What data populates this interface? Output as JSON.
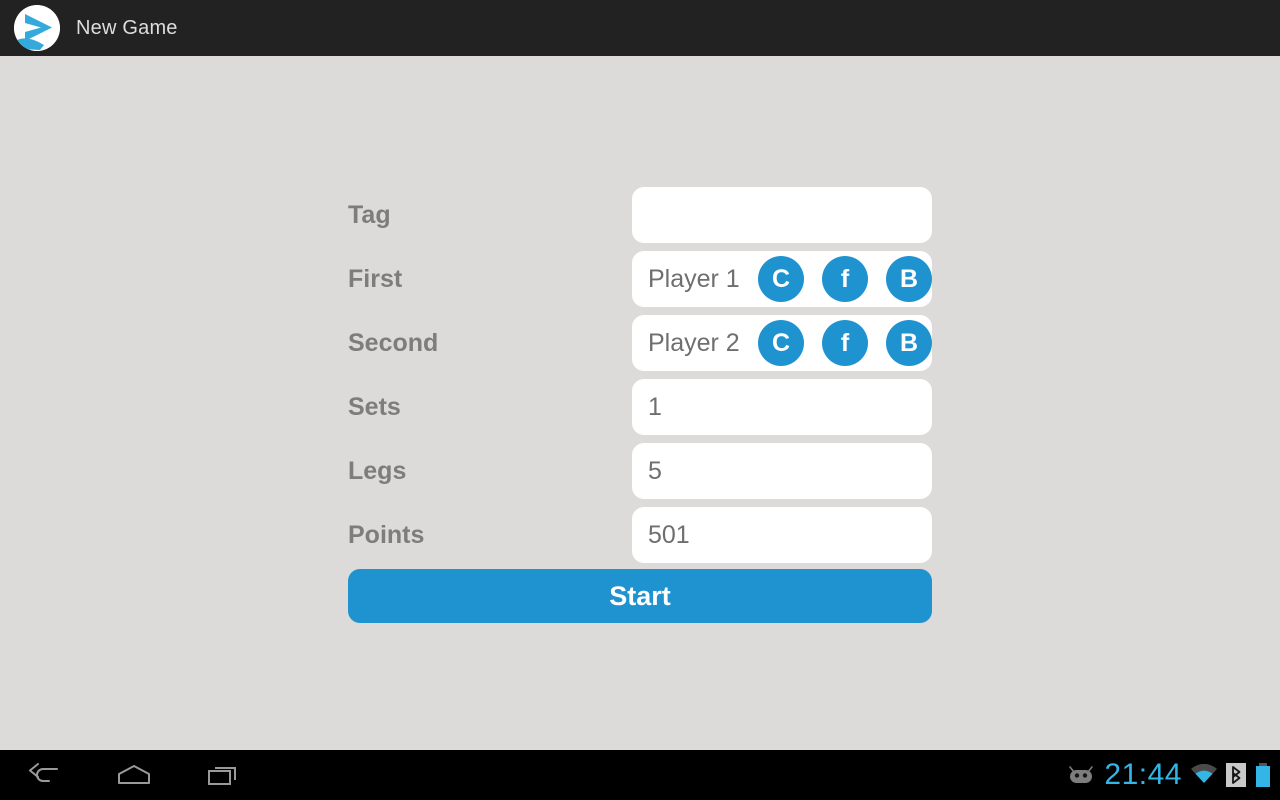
{
  "window": {
    "title": "New Game",
    "app_icon": "play-arrow-circle-icon"
  },
  "theme": {
    "background": "#dcdbd9",
    "accent_blue": "#1f93d0",
    "title_bar": "#222222",
    "field_background": "#ffffff",
    "label_color": "#7d7d7d",
    "value_color": "#6f6f6f",
    "clock_color": "#33b5e5"
  },
  "form": {
    "rows": [
      {
        "label": "Tag",
        "value": "",
        "placeholder": "",
        "has_social": false
      },
      {
        "label": "First",
        "value": "Player 1",
        "placeholder": "",
        "has_social": true,
        "social": [
          "C",
          "f",
          "B"
        ]
      },
      {
        "label": "Second",
        "value": "Player 2",
        "placeholder": "",
        "has_social": true,
        "social": [
          "C",
          "f",
          "B"
        ]
      },
      {
        "label": "Sets",
        "value": "1",
        "placeholder": "",
        "has_social": false
      },
      {
        "label": "Legs",
        "value": "5",
        "placeholder": "",
        "has_social": false
      },
      {
        "label": "Points",
        "value": "501",
        "placeholder": "",
        "has_social": false
      }
    ],
    "start_label": "Start"
  },
  "system_bar": {
    "nav": [
      {
        "name": "back",
        "icon": "back-arrow-icon"
      },
      {
        "name": "home",
        "icon": "home-icon"
      },
      {
        "name": "recents",
        "icon": "recent-apps-icon"
      }
    ],
    "clock": "21:44",
    "status_icons": [
      "android-debug-icon",
      "wifi-icon",
      "bluetooth-icon",
      "battery-icon"
    ]
  }
}
